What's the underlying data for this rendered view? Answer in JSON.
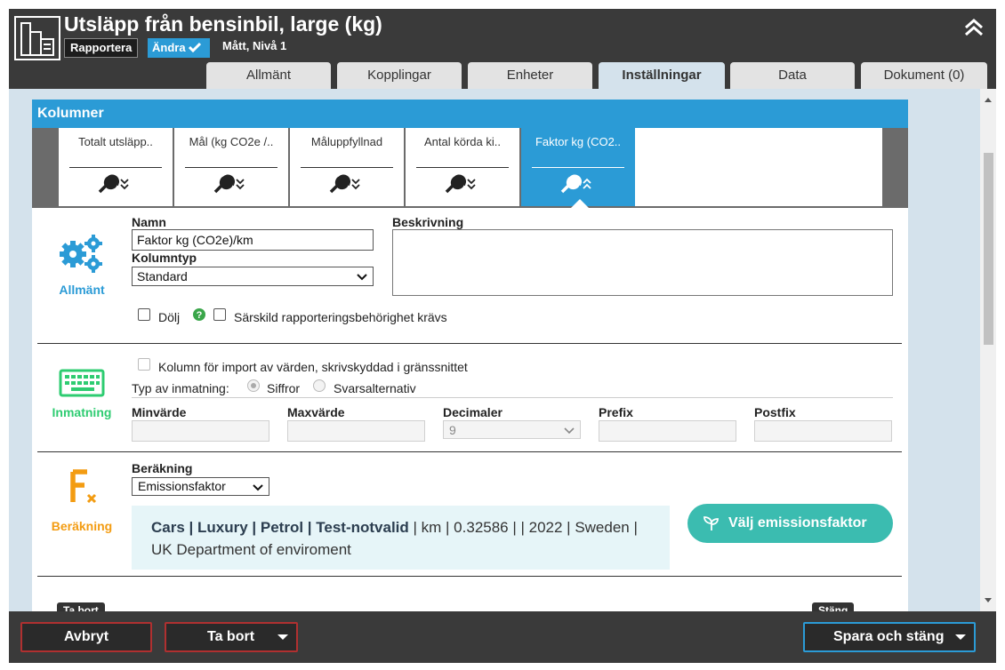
{
  "header": {
    "title": "Utsläpp från bensinbil, large (kg)",
    "rapportera_label": "Rapportera",
    "andra_label": "Ändra",
    "subtitle": "Mått, Nivå 1"
  },
  "tabs": [
    {
      "label": "Allmänt",
      "active": false
    },
    {
      "label": "Kopplingar",
      "active": false
    },
    {
      "label": "Enheter",
      "active": false
    },
    {
      "label": "Inställningar",
      "active": true
    },
    {
      "label": "Data",
      "active": false
    },
    {
      "label": "Dokument (0)",
      "active": false
    }
  ],
  "panel": {
    "title": "Kolumner",
    "columns": [
      {
        "label": "Totalt utsläpp..",
        "active": false
      },
      {
        "label": "Mål (kg CO2e /..",
        "active": false
      },
      {
        "label": "Måluppfyllnad",
        "active": false
      },
      {
        "label": "Antal körda ki..",
        "active": false
      },
      {
        "label": "Faktor kg (CO2..",
        "active": true
      }
    ]
  },
  "allmant": {
    "section_label": "Allmänt",
    "namn_label": "Namn",
    "namn_value": "Faktor kg (CO2e)/km",
    "kolumntyp_label": "Kolumntyp",
    "kolumntyp_value": "Standard",
    "beskrivning_label": "Beskrivning",
    "beskrivning_value": "",
    "dolj_label": "Dölj",
    "sarskild_label": "Särskild rapporteringsbehörighet krävs"
  },
  "inmatning": {
    "section_label": "Inmatning",
    "import_label": "Kolumn för import av värden, skrivskyddad i gränssnittet",
    "typ_label": "Typ av inmatning:",
    "siffror_label": "Siffror",
    "svarsalternativ_label": "Svarsalternativ",
    "minvarde_label": "Minvärde",
    "maxvarde_label": "Maxvärde",
    "decimaler_label": "Decimaler",
    "decimaler_value": "9",
    "prefix_label": "Prefix",
    "postfix_label": "Postfix"
  },
  "berakning": {
    "section_label": "Beräkning",
    "berakning_label": "Beräkning",
    "berakning_value": "Emissionsfaktor",
    "factor_bold": "Cars | Luxury | Petrol | Test-notvalid",
    "factor_rest": " | km | 0.32586 | | 2022 | Sweden |",
    "factor_line2": "UK Department of enviroment",
    "valj_label": "Välj emissionsfaktor"
  },
  "mini": {
    "ta_bort": "Ta bort",
    "stang": "Stäng"
  },
  "footer": {
    "avbryt": "Avbryt",
    "ta_bort": "Ta bort",
    "spara": "Spara och stäng"
  },
  "colors": {
    "accent": "#2b9bd6",
    "header_bg": "#3a3a3a",
    "inmatning": "#2ecc71",
    "berakning": "#f39c12",
    "teal_button": "#3bbcb0"
  }
}
